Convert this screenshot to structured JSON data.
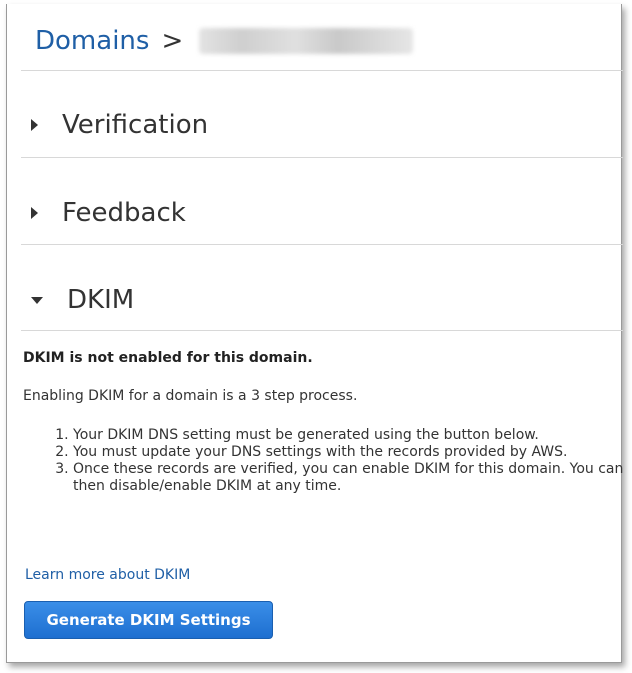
{
  "breadcrumb": {
    "root": "Domains",
    "separator": ">"
  },
  "sections": {
    "verification": "Verification",
    "feedback": "Feedback",
    "dkim": "DKIM"
  },
  "dkim": {
    "notice": "DKIM is not enabled for this domain.",
    "intro": "Enabling DKIM for a domain is a 3 step process.",
    "steps": [
      "Your DKIM DNS setting must be generated using the button below.",
      "You must update your DNS settings with the records provided by AWS.",
      "Once these records are verified, you can enable DKIM for this domain. You can then disable/enable DKIM at any time."
    ],
    "learn_more": "Learn more about DKIM",
    "generate_button": "Generate DKIM Settings"
  },
  "colors": {
    "link": "#1f5fa6",
    "button": "#1e6fd0"
  }
}
